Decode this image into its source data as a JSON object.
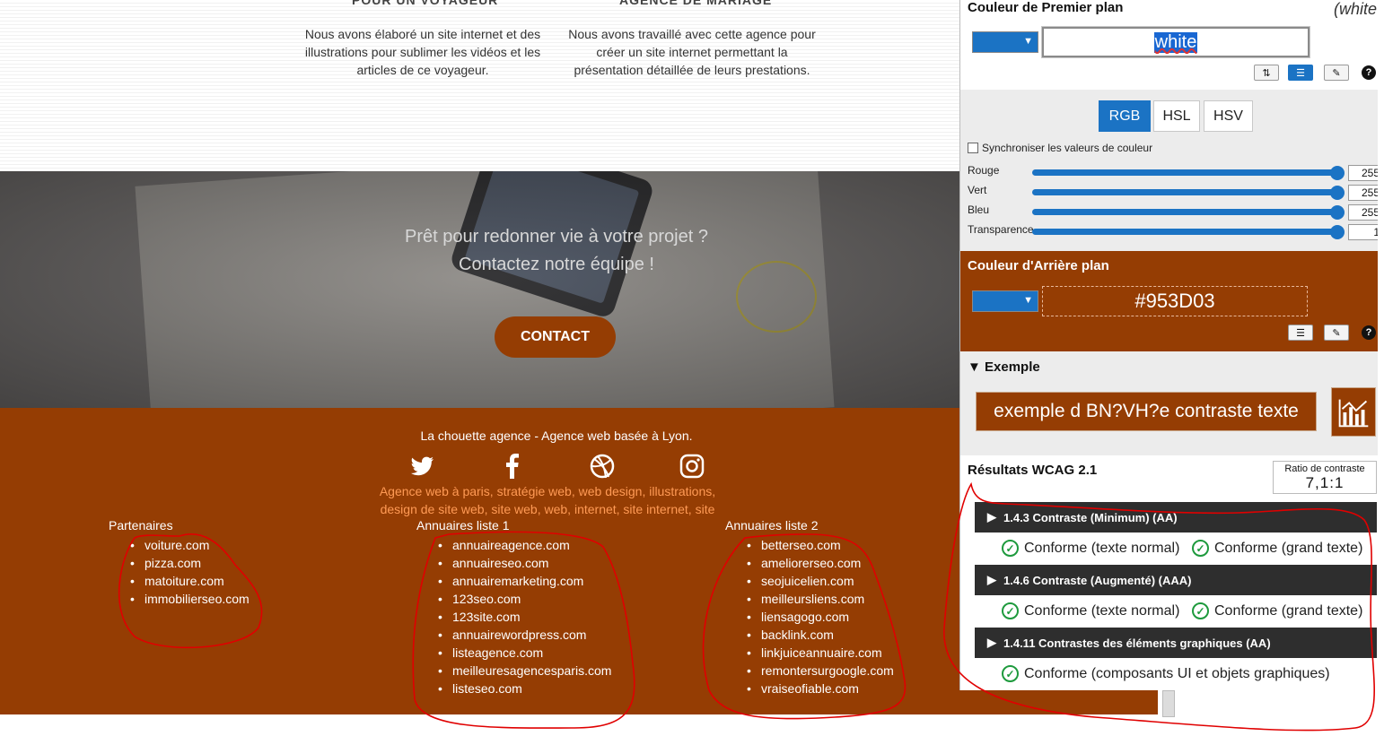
{
  "projects": [
    {
      "title": "POUR UN VOYAGEUR",
      "description": "Nous avons élaboré un site internet et des illustrations pour sublimer les vidéos et les articles de ce voyageur."
    },
    {
      "title": "AGENCE DE MARIAGE",
      "description": "Nous avons travaillé avec cette agence pour créer un site internet permettant la présentation détaillée de leurs prestations."
    }
  ],
  "hero": {
    "line1": "Prêt pour redonner vie à votre projet ?",
    "line2": "Contactez notre équipe !",
    "cta_label": "CONTACT"
  },
  "footer": {
    "tagline": "La chouette agence - Agence web basée à Lyon.",
    "social_icons": [
      "twitter-icon",
      "facebook-icon",
      "dribbble-icon",
      "instagram-icon"
    ],
    "seo_text": "Agence web à paris, stratégie web, web design, illustrations, design de site web, site web, web, internet, site internet, site",
    "columns": [
      {
        "title": "Partenaires",
        "links": [
          "voiture.com",
          "pizza.com",
          "matoiture.com",
          "immobilierseo.com"
        ]
      },
      {
        "title": "Annuaires liste 1",
        "links": [
          "annuaireagence.com",
          "annuaireseo.com",
          "annuairemarketing.com",
          "123seo.com",
          "123site.com",
          "annuairewordpress.com",
          "listeagence.com",
          "meilleuresagencesparis.com",
          "listeseo.com"
        ]
      },
      {
        "title": "Annuaires liste 2",
        "links": [
          "betterseo.com",
          "ameliorerseo.com",
          "seojuicelien.com",
          "meilleursliens.com",
          "liensagogo.com",
          "backlink.com",
          "linkjuiceannuaire.com",
          "remontersurgoogle.com",
          "vraiseofiable.com"
        ]
      }
    ]
  },
  "panel": {
    "foreground": {
      "title": "Couleur de Premier plan",
      "note": "(white",
      "value": "white",
      "swatch_color": "#1b73c4"
    },
    "modes": [
      "RGB",
      "HSL",
      "HSV"
    ],
    "active_mode": "RGB",
    "sync_label": "Synchroniser les valeurs de couleur",
    "sliders": [
      {
        "label": "Rouge",
        "value": "255"
      },
      {
        "label": "Vert",
        "value": "255"
      },
      {
        "label": "Bleu",
        "value": "255"
      },
      {
        "label": "Transparence",
        "value": "1"
      }
    ],
    "background": {
      "title": "Couleur d'Arrière plan",
      "value": "#953D03"
    },
    "example": {
      "title": "Exemple",
      "text": "exemple d BN?VH?e contraste texte"
    },
    "wcag": {
      "title": "Résultats WCAG 2.1",
      "ratio_label": "Ratio de contraste",
      "ratio_value": "7,1:1",
      "criteria": [
        {
          "name": "1.4.3 Contraste (Minimum) (AA)",
          "results": [
            "Conforme (texte normal)",
            "Conforme (grand texte)"
          ]
        },
        {
          "name": "1.4.6 Contraste (Augmenté) (AAA)",
          "results": [
            "Conforme (texte normal)",
            "Conforme (grand texte)"
          ]
        },
        {
          "name": "1.4.11 Contrastes des éléments graphiques (AA)",
          "results": [
            "Conforme (composants UI et objets graphiques)"
          ]
        }
      ]
    }
  },
  "colors": {
    "brand_brown": "#953d03",
    "accent_blue": "#1b73c4",
    "pass_green": "#1e9a3d",
    "annotation_red": "#e00000"
  }
}
